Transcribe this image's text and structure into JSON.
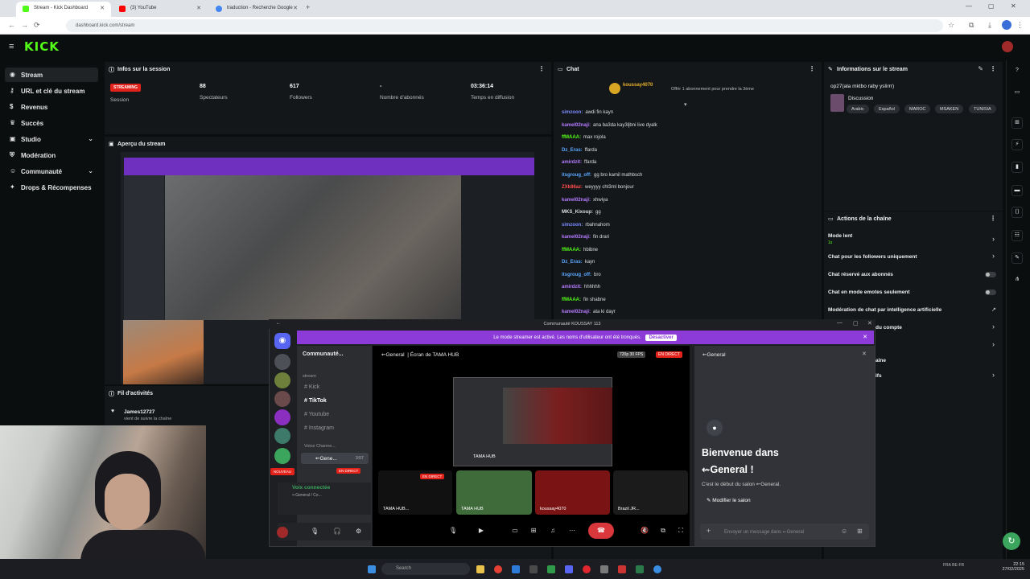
{
  "browser": {
    "tabs": [
      {
        "title": "Stream - Kick Dashboard",
        "color": "#53fc18"
      },
      {
        "title": "(3) YouTube",
        "color": "#ff0000"
      },
      {
        "title": "traduction - Recherche Google",
        "color": "#4285f4"
      }
    ],
    "url": "dashboard.kick.com/stream"
  },
  "kick": {
    "logo": "KICK",
    "nav": [
      {
        "label": "Stream",
        "icon": "broadcast-icon",
        "active": true
      },
      {
        "label": "URL et clé du stream",
        "icon": "key-icon"
      },
      {
        "label": "Revenus",
        "icon": "money-icon"
      },
      {
        "label": "Succès",
        "icon": "trophy-icon"
      },
      {
        "label": "Studio",
        "icon": "studio-icon",
        "expandable": true
      },
      {
        "label": "Modération",
        "icon": "shield-icon"
      },
      {
        "label": "Communauté",
        "icon": "users-icon",
        "expandable": true
      },
      {
        "label": "Drops & Récompenses",
        "icon": "gift-icon"
      }
    ],
    "session": {
      "title": "Infos sur la session",
      "badge": "STREAMING",
      "stats": [
        {
          "label": "Session",
          "value": ""
        },
        {
          "label": "Spectateurs",
          "value": "88"
        },
        {
          "label": "Followers",
          "value": "617"
        },
        {
          "label": "Nombre d'abonnés",
          "value": "-"
        },
        {
          "label": "Temps en diffusion",
          "value": "03:36:14"
        }
      ]
    },
    "preview": {
      "title": "Aperçu du stream"
    },
    "activity": {
      "title": "Fil d'activités",
      "items": [
        {
          "user": "James12727",
          "text": "vient de suivre la chaîne"
        }
      ]
    },
    "chat": {
      "title": "Chat",
      "pinned": {
        "user": "koussay4070",
        "text": "Offrir 1 abonnement pour prendre la 3ème"
      },
      "messages": [
        {
          "user": "simzoon:",
          "text": "awdi fin kayn",
          "color": "#7b8cff"
        },
        {
          "user": "kamel02naji:",
          "text": "ana ba3da kay3ljbni live dyalk",
          "color": "#b57bff"
        },
        {
          "user": "ffMAAA:",
          "text": "max rojola",
          "color": "#53fc18"
        },
        {
          "user": "Dz_Eras:",
          "text": "ffarda",
          "color": "#5aa7ff"
        },
        {
          "user": "amirdzit:",
          "text": "ffarda",
          "color": "#b57bff"
        },
        {
          "user": "itsgroug_off:",
          "text": "gg bro kamil mathbsch",
          "color": "#5aa7ff"
        },
        {
          "user": "ZXk86az:",
          "text": "weyyyy cht3ml bonjour",
          "color": "#ff4b4b"
        },
        {
          "user": "kamel02naji:",
          "text": "xhwiya",
          "color": "#b57bff"
        },
        {
          "user": "MKS_Kixoup:",
          "text": "gg",
          "color": "#dddddd"
        },
        {
          "user": "simzoon:",
          "text": "rbahnahom",
          "color": "#7b8cff"
        },
        {
          "user": "kamel02naji:",
          "text": "fin drari",
          "color": "#b57bff"
        },
        {
          "user": "ffMAAA:",
          "text": "hbibne",
          "color": "#53fc18"
        },
        {
          "user": "Dz_Eras:",
          "text": "kayn",
          "color": "#5aa7ff"
        },
        {
          "user": "itsgroug_off:",
          "text": "bro",
          "color": "#5aa7ff"
        },
        {
          "user": "amirdzit:",
          "text": "hhhhhh",
          "color": "#b57bff"
        },
        {
          "user": "ffMAAA:",
          "text": "fin shabne",
          "color": "#53fc18"
        },
        {
          "user": "kamel02naji:",
          "text": "ata ki dayr",
          "color": "#b57bff"
        }
      ]
    },
    "info": {
      "title": "Informations sur le stream",
      "stream_title": "op27(ala mktbo raby yslirrr)",
      "category": "Discussion",
      "tags": [
        "Arabic",
        "Español",
        "MAROC",
        "MSAKEN",
        "TUNISIA"
      ]
    },
    "actions": {
      "title": "Actions de la chaîne",
      "items": [
        {
          "label": "Mode lent",
          "sub": "1s",
          "type": "chevron"
        },
        {
          "label": "Chat pour les followers uniquement",
          "type": "chevron"
        },
        {
          "label": "Chat réservé aux abonnés",
          "type": "toggle"
        },
        {
          "label": "Chat en mode emotes seulement",
          "type": "toggle"
        },
        {
          "label": "Modération de chat par intelligence artificielle",
          "type": "link"
        }
      ]
    }
  },
  "discord": {
    "window_title": "Communauté KOUSSAY 113",
    "banner": "Le mode streamer est activé. Les noms d'utilisateur ont été tronqués.",
    "banner_button": "Désactiver",
    "server_name": "Communauté...",
    "category": "stream",
    "channels": [
      "Kick",
      "TikTok",
      "Youtube",
      "Instagram"
    ],
    "voice_category": "Voice Channe...",
    "voice_channel": "⇜Gene...",
    "voice_time": "3:57",
    "live_label": "EN DIRECT",
    "voice_status": "Voix connectée",
    "voice_sub": "⇜General / Co...",
    "stage_header": "⇜General",
    "stage_screen": "Écran de",
    "stage_hub": "TAMA HUB",
    "stage_quality": "720p 30 FPS",
    "tiles": [
      {
        "name": "TAMA HUB...",
        "live": true
      },
      {
        "name": "TAMA HUB",
        "live": false
      },
      {
        "name": "koussay4070",
        "live": false
      },
      {
        "name": "Brazil JR...",
        "live": false
      }
    ],
    "screen_label": "TAMA HUB",
    "side_channel": "⇜General",
    "welcome": "Bienvenue dans",
    "welcome_channel": "⇜General !",
    "welcome_sub": "C'est le début du salon",
    "welcome_sub_channel": "⇜General.",
    "edit_channel": "Modifier le salon",
    "message_placeholder": "Envoyer un message dans",
    "message_placeholder_channel": "⇜General"
  },
  "partial_labels": [
    "du compte",
    "aîne",
    "ifs"
  ],
  "taskbar": {
    "search": "Search",
    "time": "22:15",
    "date": "27/02/2025",
    "lang": "FRA BE-FR"
  }
}
